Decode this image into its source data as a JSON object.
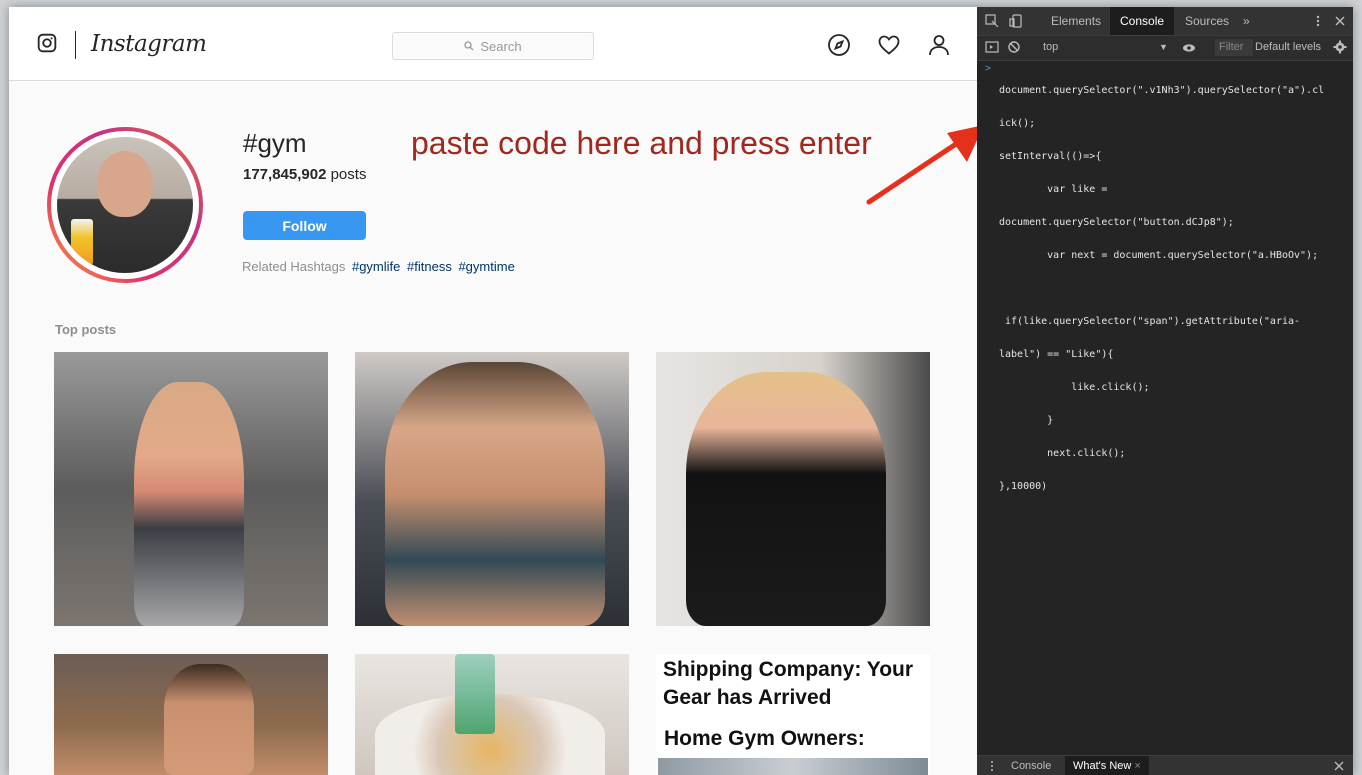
{
  "instagram": {
    "brand": "Instagram",
    "search_placeholder": "Search",
    "hashtag": {
      "title": "#gym",
      "post_count": "177,845,902",
      "post_label": "posts",
      "follow_label": "Follow",
      "related_label": "Related Hashtags",
      "related": [
        "#gymlife",
        "#fitness",
        "#gymtime"
      ]
    },
    "top_posts_label": "Top posts",
    "ad": {
      "title": "Shipping Company: Your Gear has Arrived",
      "subtitle": "Home Gym Owners:"
    }
  },
  "annotation": "paste code here and press enter",
  "annotation_color": "#a0281e",
  "devtools": {
    "tabs": [
      "Elements",
      "Console",
      "Sources",
      "»"
    ],
    "active_tab": "Console",
    "context": "top",
    "filter_placeholder": "Filter",
    "levels": "Default levels",
    "prompt": ">",
    "code_lines": [
      "document.querySelector(\".v1Nh3\").querySelector(\"a\").cl",
      "ick();",
      "setInterval(()=>{",
      "        var like =",
      "document.querySelector(\"button.dCJp8\");",
      "        var next = document.querySelector(\"a.HBoOv\");",
      "",
      " if(like.querySelector(\"span\").getAttribute(\"aria-",
      "label\") == \"Like\"){",
      "            like.click();",
      "        }",
      "        next.click();",
      "},10000)"
    ],
    "drawer_tabs": [
      "Console",
      "What's New"
    ],
    "active_drawer_tab": "What's New",
    "drawer_close": "×"
  },
  "colors": {
    "follow_blue": "#3897f0",
    "link_blue": "#003569",
    "devtools_bg": "#242424"
  }
}
